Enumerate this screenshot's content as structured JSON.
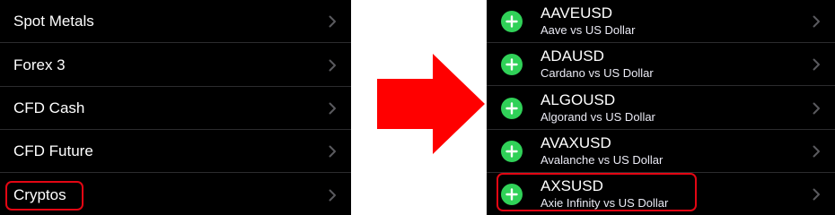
{
  "left_panel": {
    "items": [
      {
        "label": "Spot Metals"
      },
      {
        "label": "Forex 3"
      },
      {
        "label": "CFD Cash"
      },
      {
        "label": "CFD Future"
      },
      {
        "label": "Cryptos"
      }
    ]
  },
  "right_panel": {
    "items": [
      {
        "symbol": "AAVEUSD",
        "description": "Aave vs US Dollar"
      },
      {
        "symbol": "ADAUSD",
        "description": "Cardano vs US Dollar"
      },
      {
        "symbol": "ALGOUSD",
        "description": "Algorand vs US Dollar"
      },
      {
        "symbol": "AVAXUSD",
        "description": "Avalanche vs US Dollar"
      },
      {
        "symbol": "AXSUSD",
        "description": "Axie Infinity vs US Dollar"
      }
    ]
  },
  "colors": {
    "panel_bg": "#000000",
    "add_icon": "#30d158",
    "highlight": "#e30613",
    "arrow": "#ff0000"
  },
  "icons": {
    "row_chevron": "chevron-right-icon",
    "add": "plus-circle-icon",
    "transition": "right-arrow-icon"
  }
}
